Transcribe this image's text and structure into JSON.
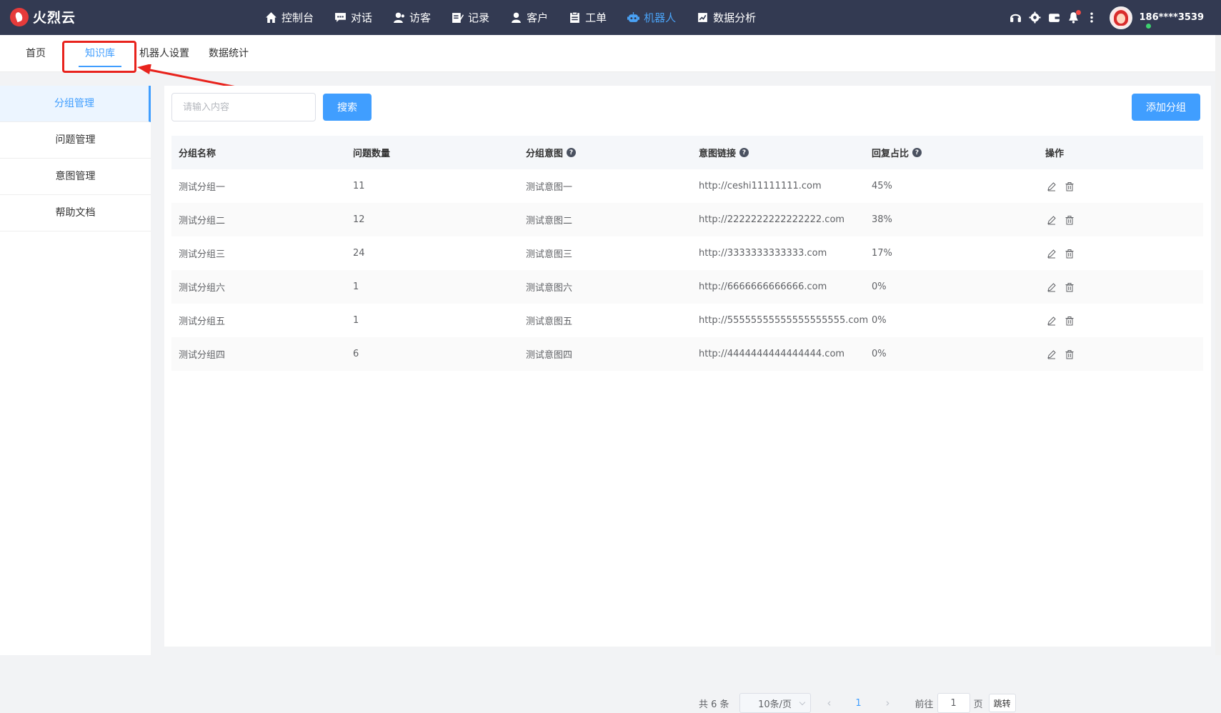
{
  "app": {
    "name": "火烈云"
  },
  "nav": [
    {
      "label": "控制台",
      "icon": "home-icon"
    },
    {
      "label": "对话",
      "icon": "chat-icon"
    },
    {
      "label": "访客",
      "icon": "visitor-icon"
    },
    {
      "label": "记录",
      "icon": "record-icon"
    },
    {
      "label": "客户",
      "icon": "customer-icon"
    },
    {
      "label": "工单",
      "icon": "ticket-icon"
    },
    {
      "label": "机器人",
      "icon": "robot-icon",
      "active": true
    },
    {
      "label": "数据分析",
      "icon": "analytics-icon"
    }
  ],
  "user": {
    "name": "186****3539"
  },
  "subtabs": [
    "首页",
    "知识库",
    "机器人设置",
    "数据统计"
  ],
  "sidebar": [
    "分组管理",
    "问题管理",
    "意图管理",
    "帮助文档"
  ],
  "search": {
    "placeholder": "请输入内容",
    "button": "搜索"
  },
  "add_button": "添加分组",
  "table": {
    "headers": [
      "分组名称",
      "问题数量",
      "分组意图",
      "意图链接",
      "回复占比",
      "操作"
    ],
    "rows": [
      [
        "测试分组一",
        "11",
        "测试意图一",
        "http://ceshi11111111.com",
        "45%"
      ],
      [
        "测试分组二",
        "12",
        "测试意图二",
        "http://2222222222222222.com",
        "38%"
      ],
      [
        "测试分组三",
        "24",
        "测试意图三",
        "http://3333333333333.com",
        "17%"
      ],
      [
        "测试分组六",
        "1",
        "测试意图六",
        "http://6666666666666.com",
        "0%"
      ],
      [
        "测试分组五",
        "1",
        "测试意图五",
        "http://55555555555555555555.com",
        "0%"
      ],
      [
        "测试分组四",
        "6",
        "测试意图四",
        "http://4444444444444444.com",
        "0%"
      ]
    ]
  },
  "pagination": {
    "total": "共 6 条",
    "page_size": "10条/页",
    "current_page": "1",
    "goto_prefix": "前往",
    "goto_value": "1",
    "goto_suffix": "页",
    "jump": "跳转"
  },
  "colors": {
    "topbar": "#333a52",
    "accent": "#409eff",
    "highlight": "#e8231d"
  }
}
